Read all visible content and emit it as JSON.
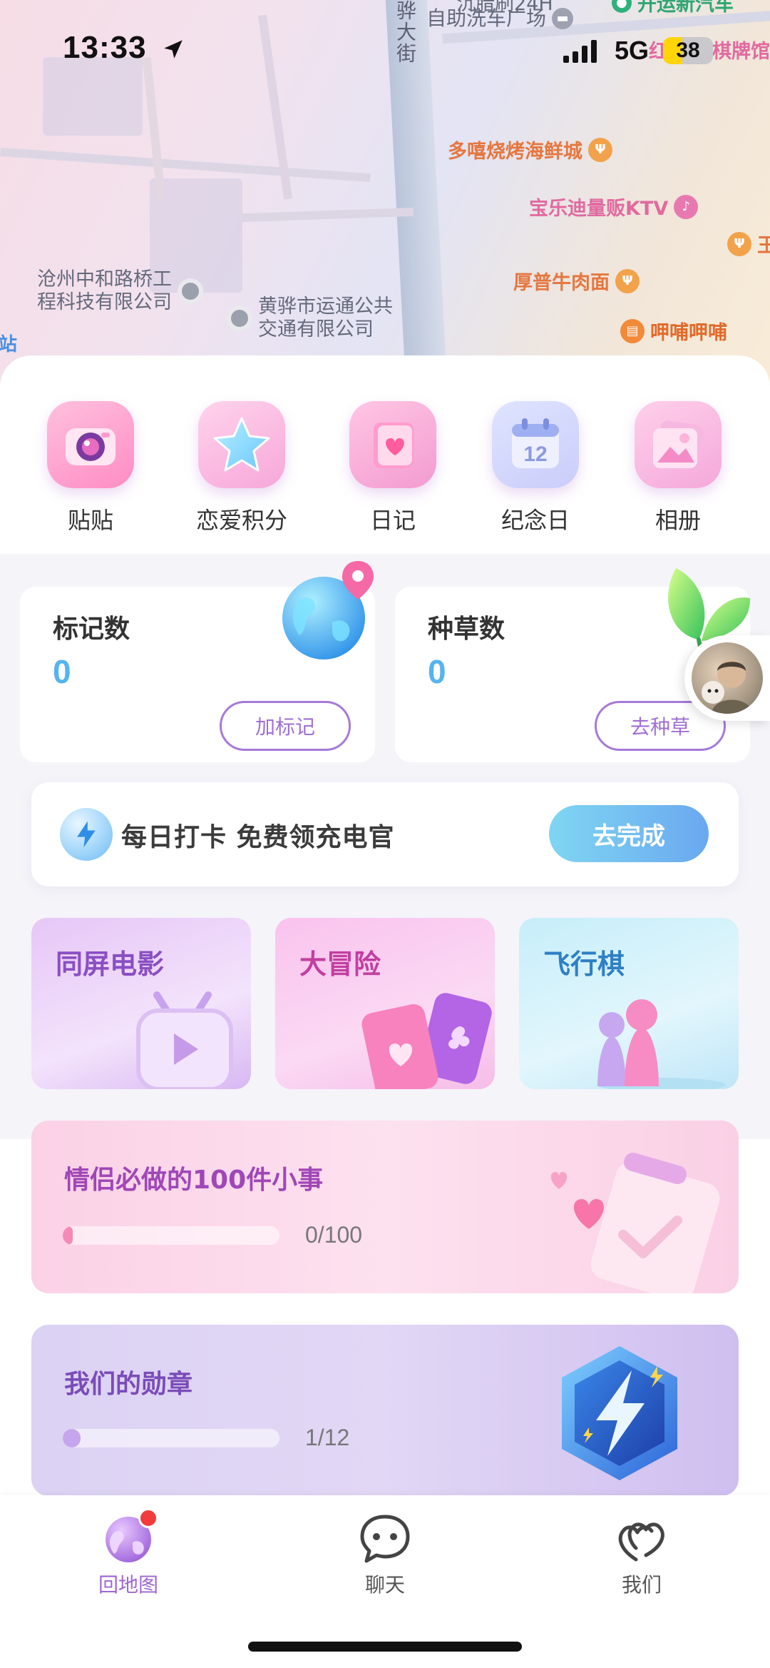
{
  "status_bar": {
    "time": "13:33",
    "network": "5G",
    "battery": "38",
    "battery_level": 0.38
  },
  "map": {
    "street": "骅大街",
    "pois": {
      "car_wash_partial": "沉腊刷24H",
      "car_wash": "自助洗车广场",
      "top_right_partial": "开运新汽车",
      "chess_partial": "红",
      "chess_suffix": "棋牌馆",
      "bbq": "多嘻烧烤海鲜城",
      "ktv": "宝乐迪量贩KTV",
      "beef": "厚普牛肉面",
      "hula": "呷哺呷哺",
      "right_edge": "王",
      "company1_line1": "沧州中和路桥工",
      "company1_line2": "程科技有限公司",
      "company2_line1": "黄骅市运通公共",
      "company2_line2": "交通有限公司",
      "left_edge": "站"
    }
  },
  "quick_actions": [
    {
      "label": "贴贴",
      "icon": "camera-icon"
    },
    {
      "label": "恋爱积分",
      "icon": "star-icon"
    },
    {
      "label": "日记",
      "icon": "diary-icon"
    },
    {
      "label": "纪念日",
      "icon": "calendar-icon"
    },
    {
      "label": "相册",
      "icon": "album-icon"
    }
  ],
  "calendar_icon_day": "12",
  "stats": {
    "marks": {
      "title": "标记数",
      "value": "0",
      "button": "加标记"
    },
    "plants": {
      "title": "种草数",
      "value": "0",
      "button": "去种草"
    }
  },
  "checkin": {
    "text": "每日打卡 免费领充电官",
    "button": "去完成"
  },
  "games": [
    {
      "title": "同屏电影",
      "icon": "tv-play-icon"
    },
    {
      "title": "大冒险",
      "icon": "cards-icon"
    },
    {
      "title": "飞行棋",
      "icon": "chess-pieces-icon"
    }
  ],
  "todo": {
    "title": "情侣必做的100件小事",
    "progress_text": "0/100",
    "progress": 0.0
  },
  "medals": {
    "title": "我们的勋章",
    "progress_text": "1/12",
    "progress": 0.083
  },
  "tabs": [
    {
      "label": "回地图",
      "icon": "planet-icon",
      "active": true,
      "badge": true
    },
    {
      "label": "聊天",
      "icon": "chat-bubble-icon",
      "active": false
    },
    {
      "label": "我们",
      "icon": "hearts-icon",
      "active": false
    }
  ],
  "colors": {
    "accent_purple": "#a066d6",
    "number_blue": "#55b4f0",
    "checkin_gradient_start": "#7fd6f2",
    "checkin_gradient_end": "#6aa8f0",
    "badge_red": "#f23c3c"
  }
}
